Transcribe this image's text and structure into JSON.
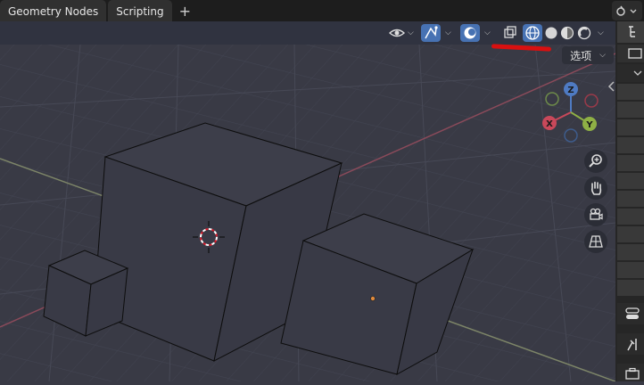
{
  "tabs": [
    {
      "label": "Geometry Nodes"
    },
    {
      "label": "Scripting"
    }
  ],
  "add_tab": "+",
  "header": {
    "options_label": "选项",
    "shading_modes": [
      "wireframe",
      "solid",
      "material",
      "rendered"
    ],
    "active_shading": "wireframe"
  },
  "gizmo": {
    "x": "X",
    "y": "Y",
    "z": "Z"
  },
  "icons": {
    "visibility": "eye-icon",
    "gizmo_toggle": "gizmo-icon",
    "overlay": "overlay-icon",
    "xray": "xray-icon",
    "zoom": "zoom-icon",
    "pan": "hand-icon",
    "camera": "camera-icon",
    "ortho": "grid-perspective-icon"
  },
  "colors": {
    "accent": "#4772b3",
    "x_axis": "#c8485a",
    "y_axis": "#8fb045",
    "z_axis": "#4f7bc3",
    "annotation": "#d81010"
  }
}
